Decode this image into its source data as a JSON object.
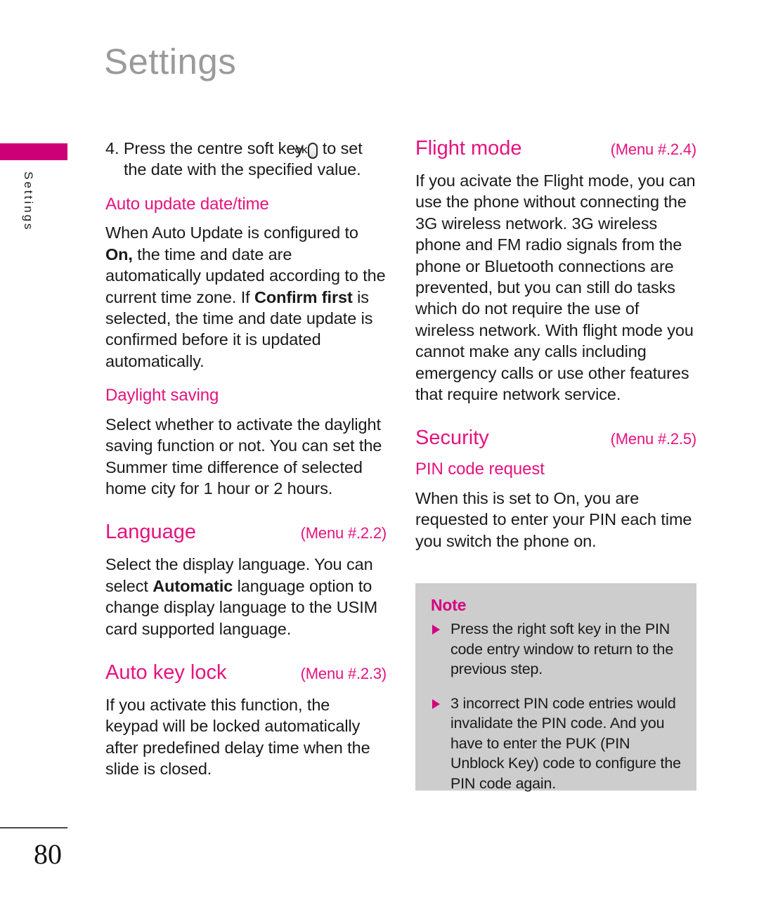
{
  "page": {
    "title": "Settings",
    "number": "80",
    "side_tab_label": "Settings",
    "accent_pink": "#e6127f",
    "tab_magenta": "#ce0078",
    "note_bg": "#cdcdcd",
    "title_gray": "#9a9a9a"
  },
  "left_column": {
    "step_four": {
      "before_icon": "4. Press the centre soft key ",
      "icon_label": "OK",
      "after_icon": " to set the date with the specified value."
    },
    "auto_update": {
      "heading": "Auto update date/time",
      "paragraph_1": "When Auto Update is configured to ",
      "bold_1": "On,",
      "paragraph_2": " the time and date are automatically updated according to the current time zone. If ",
      "bold_2": "Confirm first",
      "paragraph_3": " is selected, the time and date update is confirmed before it is updated automatically."
    },
    "daylight_saving": {
      "heading": "Daylight saving",
      "paragraph": "Select whether to activate the daylight saving function or not. You can set the Summer time difference of selected home city for 1 hour or 2 hours."
    },
    "language": {
      "heading": "Language",
      "menu_ref": "(Menu #.2.2)",
      "paragraph_1": "Select the display language. You can select ",
      "bold_1": "Automatic",
      "paragraph_2": " language option to change display language to the USIM card supported language."
    },
    "auto_key_lock": {
      "heading": "Auto key lock",
      "menu_ref": "(Menu #.2.3)",
      "paragraph": "If you activate this function, the keypad will be locked automatically after predefined delay time when the slide is closed."
    }
  },
  "right_column": {
    "flight_mode": {
      "heading": "Flight mode",
      "menu_ref": "(Menu #.2.4)",
      "paragraph": "If you acivate the Flight mode, you can use the phone without connecting the 3G wireless network. 3G wireless phone and FM radio signals from the phone or Bluetooth connections are prevented, but you can still do tasks which do not require the use of wireless network. With flight mode you cannot make any calls including emergency calls or use other features that require network service."
    },
    "security": {
      "heading": "Security",
      "menu_ref": "(Menu #.2.5)",
      "sub_heading": "PIN code request",
      "paragraph": "When this is set to On, you are requested to enter your PIN each time you switch the phone on."
    },
    "note": {
      "title": "Note",
      "items": [
        "Press the right soft key in the PIN code entry window to return to the previous step.",
        "3 incorrect PIN code entries would invalidate the PIN code. And you have to enter the PUK (PIN Unblock Key) code to configure the PIN code again."
      ]
    }
  }
}
